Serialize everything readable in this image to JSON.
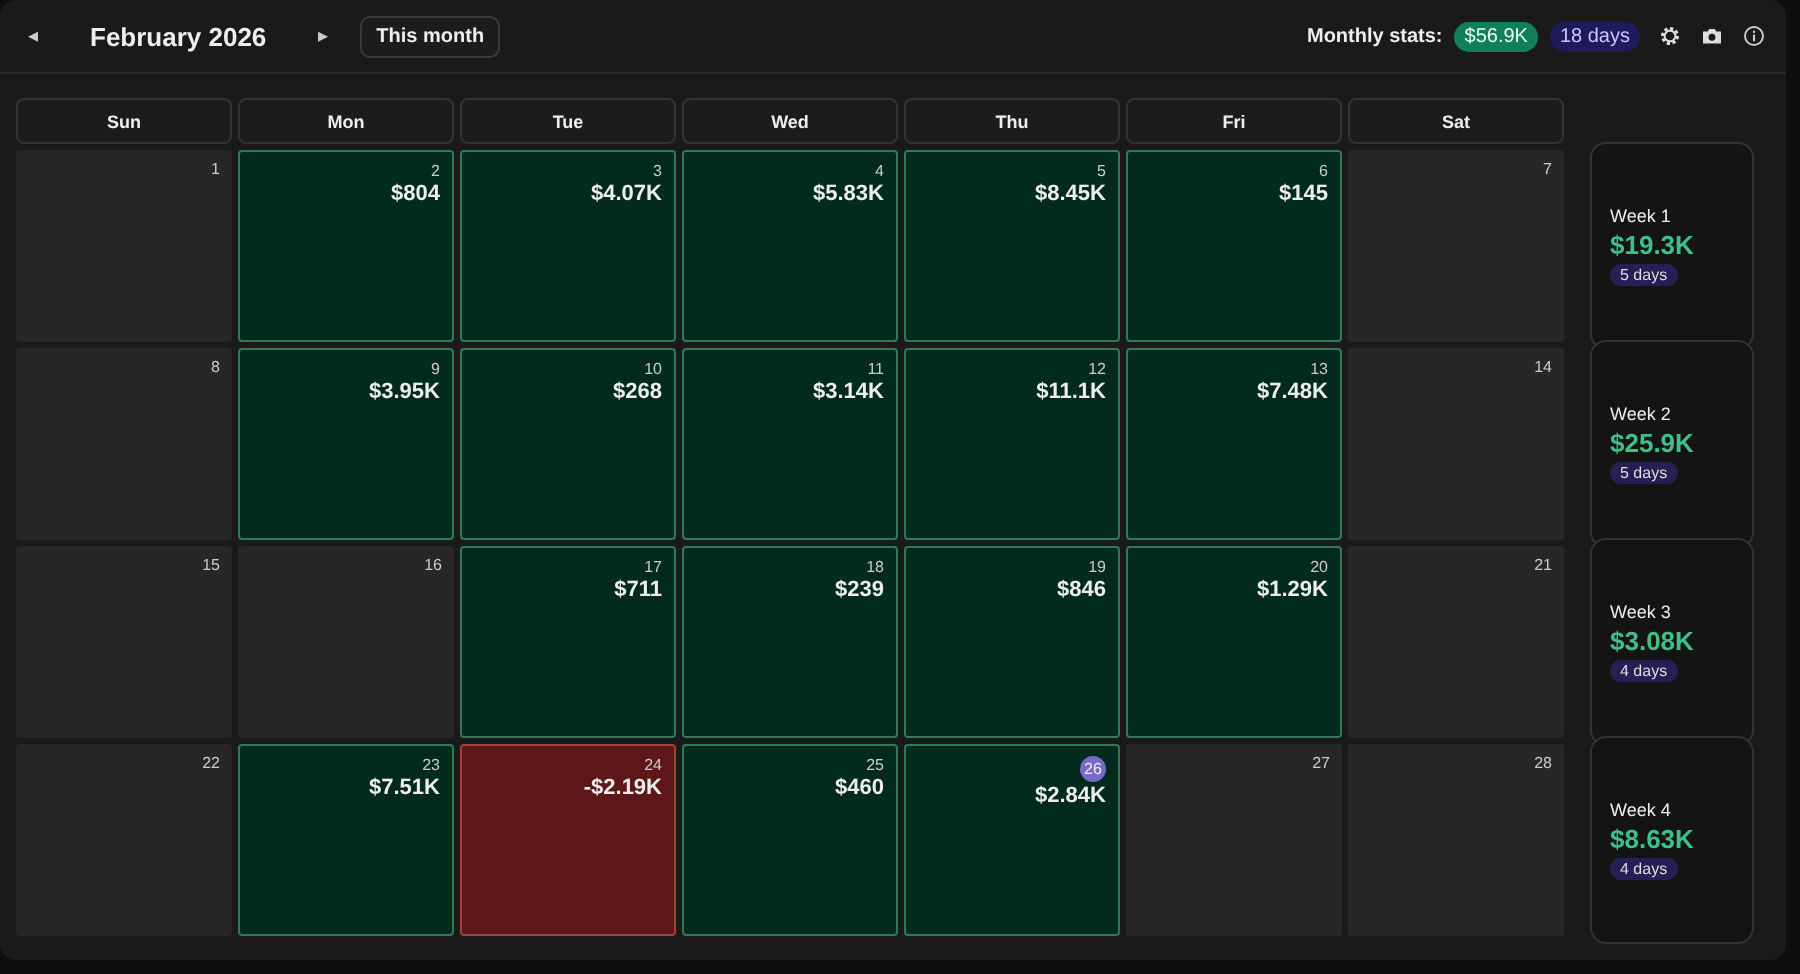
{
  "header": {
    "prev": "◂",
    "title": "February 2026",
    "next": "▸",
    "today_button": "This month",
    "stats_label": "Monthly stats:",
    "stats_total": "$56.9K",
    "stats_days": "18 days"
  },
  "weekdays": [
    "Sun",
    "Mon",
    "Tue",
    "Wed",
    "Thu",
    "Fri",
    "Sat"
  ],
  "weeks": [
    {
      "label": "Week 1",
      "total": "$19.3K",
      "days_count": "5 days",
      "days": [
        {
          "date": "1",
          "kind": "empty",
          "selected": false
        },
        {
          "date": "2",
          "kind": "profit",
          "amount": "$804",
          "selected": false
        },
        {
          "date": "3",
          "kind": "profit",
          "amount": "$4.07K",
          "selected": false
        },
        {
          "date": "4",
          "kind": "profit",
          "amount": "$5.83K",
          "selected": false
        },
        {
          "date": "5",
          "kind": "profit",
          "amount": "$8.45K",
          "selected": false
        },
        {
          "date": "6",
          "kind": "profit",
          "amount": "$145",
          "selected": false
        },
        {
          "date": "7",
          "kind": "empty",
          "selected": false
        }
      ]
    },
    {
      "label": "Week 2",
      "total": "$25.9K",
      "days_count": "5 days",
      "days": [
        {
          "date": "8",
          "kind": "empty",
          "selected": false
        },
        {
          "date": "9",
          "kind": "profit",
          "amount": "$3.95K",
          "selected": false
        },
        {
          "date": "10",
          "kind": "profit",
          "amount": "$268",
          "selected": false
        },
        {
          "date": "11",
          "kind": "profit",
          "amount": "$3.14K",
          "selected": false
        },
        {
          "date": "12",
          "kind": "profit",
          "amount": "$11.1K",
          "selected": false
        },
        {
          "date": "13",
          "kind": "profit",
          "amount": "$7.48K",
          "selected": false
        },
        {
          "date": "14",
          "kind": "empty",
          "selected": false
        }
      ]
    },
    {
      "label": "Week 3",
      "total": "$3.08K",
      "days_count": "4 days",
      "days": [
        {
          "date": "15",
          "kind": "empty",
          "selected": false
        },
        {
          "date": "16",
          "kind": "empty",
          "selected": false
        },
        {
          "date": "17",
          "kind": "profit",
          "amount": "$711",
          "selected": false
        },
        {
          "date": "18",
          "kind": "profit",
          "amount": "$239",
          "selected": false
        },
        {
          "date": "19",
          "kind": "profit",
          "amount": "$846",
          "selected": false
        },
        {
          "date": "20",
          "kind": "profit",
          "amount": "$1.29K",
          "selected": false
        },
        {
          "date": "21",
          "kind": "empty",
          "selected": false
        }
      ]
    },
    {
      "label": "Week 4",
      "total": "$8.63K",
      "days_count": "4 days",
      "days": [
        {
          "date": "22",
          "kind": "empty",
          "selected": false
        },
        {
          "date": "23",
          "kind": "profit",
          "amount": "$7.51K",
          "selected": false
        },
        {
          "date": "24",
          "kind": "loss",
          "amount": "-$2.19K",
          "selected": false
        },
        {
          "date": "25",
          "kind": "profit",
          "amount": "$460",
          "selected": false
        },
        {
          "date": "26",
          "kind": "profit",
          "amount": "$2.84K",
          "selected": true
        },
        {
          "date": "27",
          "kind": "empty",
          "selected": false
        },
        {
          "date": "28",
          "kind": "empty",
          "selected": false
        }
      ]
    }
  ]
}
